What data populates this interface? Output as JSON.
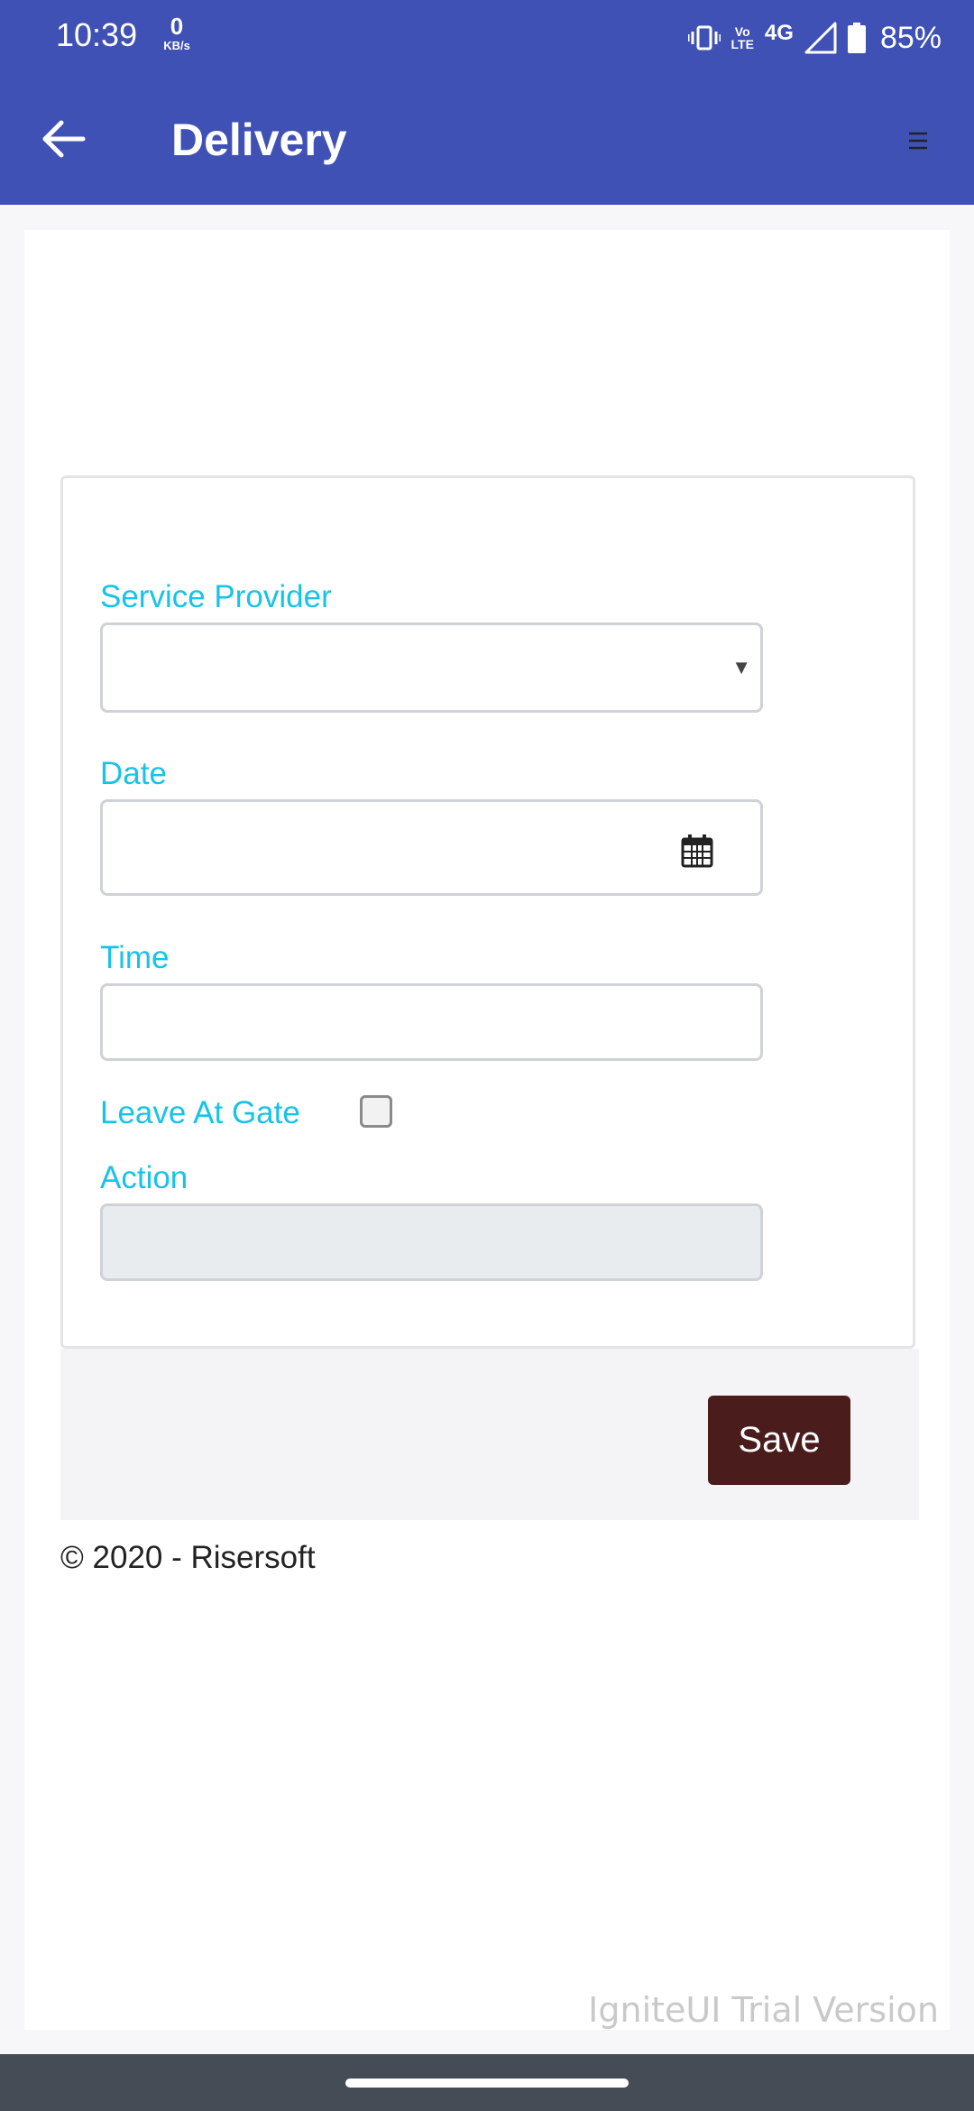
{
  "status_bar": {
    "time": "10:39",
    "net_speed_value": "0",
    "net_speed_unit": "KB/s",
    "volte_top": "Vo",
    "volte_bottom": "LTE",
    "network": "4G",
    "battery": "85%"
  },
  "app_bar": {
    "title": "Delivery",
    "back_icon": "arrow-left-icon",
    "menu_icon": "hamburger-menu-icon",
    "color": "#3f51b5"
  },
  "form": {
    "service_provider_label": "Service Provider",
    "service_provider_value": "",
    "date_label": "Date",
    "date_value": "",
    "time_label": "Time",
    "time_value": "",
    "leave_at_gate_label": "Leave At Gate",
    "leave_at_gate_checked": false,
    "action_label": "Action",
    "action_value": "",
    "label_color": "#17c3e8"
  },
  "footer": {
    "save_label": "Save",
    "save_color": "#4a1c1c",
    "copyright": "© 2020 - Risersoft",
    "watermark": "IgniteUI Trial Version"
  }
}
